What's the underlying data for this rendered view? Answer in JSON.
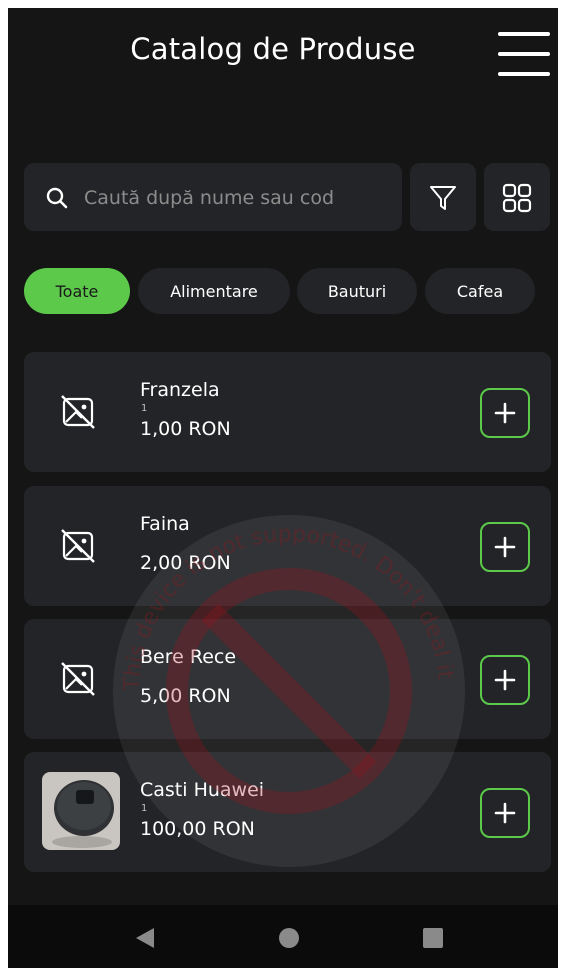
{
  "header": {
    "title": "Catalog de Produse",
    "menu_icon": "hamburger-menu-icon"
  },
  "search": {
    "placeholder": "Caută după nume sau cod",
    "value": ""
  },
  "toolbar": {
    "filter_icon": "filter-icon",
    "grid_icon": "grid-view-icon"
  },
  "categories": [
    {
      "label": "Toate",
      "active": true
    },
    {
      "label": "Alimentare",
      "active": false
    },
    {
      "label": "Bauturi",
      "active": false
    },
    {
      "label": "Cafea",
      "active": false
    }
  ],
  "products": [
    {
      "name": "Franzela",
      "code": "1",
      "price": "1,00 RON",
      "image": "no-image-icon"
    },
    {
      "name": "Faina",
      "code": "",
      "price": "2,00 RON",
      "image": "no-image-icon"
    },
    {
      "name": "Bere Rece",
      "code": "",
      "price": "5,00 RON",
      "image": "no-image-icon"
    },
    {
      "name": "Casti  Huawei",
      "code": "1",
      "price": "100,00 RON",
      "image": "earbuds-photo"
    }
  ],
  "watermark": {
    "text": "This device is not supported. Don't deal it",
    "icon": "prohibited-icon"
  },
  "colors": {
    "background": "#151515",
    "card": "#232427",
    "accent": "#5cc94a",
    "text": "#ffffff"
  },
  "system_nav": {
    "back_icon": "back-triangle-icon",
    "home_icon": "home-circle-icon",
    "recents_icon": "recents-square-icon"
  }
}
